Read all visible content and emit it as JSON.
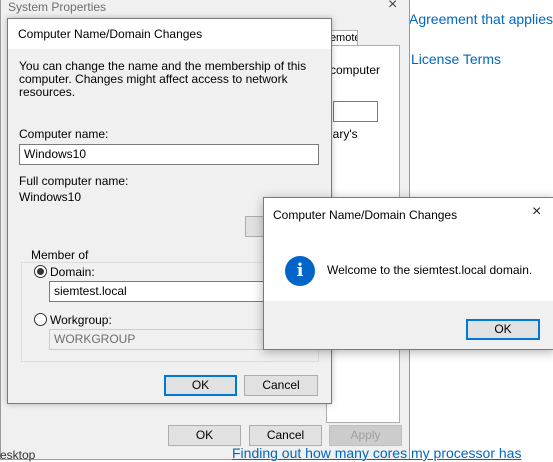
{
  "background": {
    "links": [
      "Agreement that applies",
      "License Terms"
    ],
    "bottom_text_left": "esktop",
    "bottom_link": "Finding out how many cores my processor has"
  },
  "system_properties": {
    "title": "System Properties",
    "close_glyph": "×",
    "tab_remote": "Remote",
    "panel_text_1": "computer",
    "panel_text_2": "lary's",
    "buttons": {
      "ok": "OK",
      "cancel": "Cancel",
      "apply": "Apply"
    }
  },
  "domain_dialog": {
    "title": "Computer Name/Domain Changes",
    "description": "You can change the name and the membership of this computer. Changes might affect access to network resources.",
    "computer_name_label": "Computer name:",
    "computer_name_value": "Windows10",
    "full_name_label": "Full computer name:",
    "full_name_value": "Windows10",
    "member_of_label": "Member of",
    "domain_label": "Domain:",
    "domain_value": "siemtest.local",
    "workgroup_label": "Workgroup:",
    "workgroup_value": "WORKGROUP",
    "selected_membership": "Domain",
    "buttons": {
      "ok": "OK",
      "cancel": "Cancel"
    }
  },
  "welcome_box": {
    "title": "Computer Name/Domain Changes",
    "close_glyph": "×",
    "icon": "info-icon",
    "message": "Welcome to the siemtest.local domain.",
    "ok": "OK"
  },
  "colors": {
    "link": "#0067c0",
    "info_icon": "#0064c8",
    "default_button_border": "#0078d7"
  }
}
